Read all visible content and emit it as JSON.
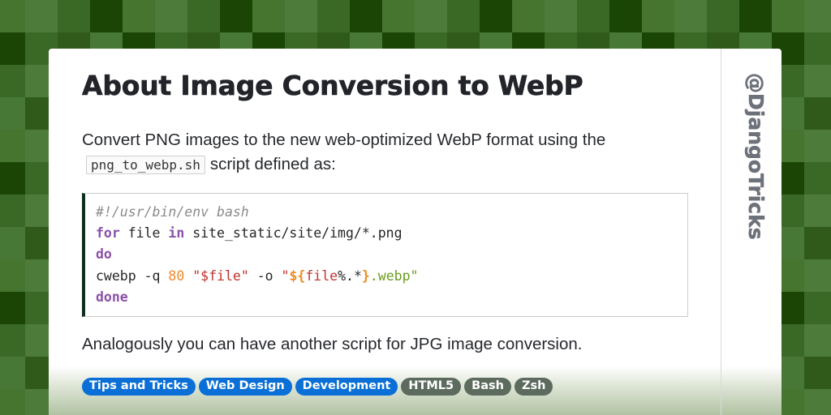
{
  "background": {
    "palette": [
      "#467530",
      "#4d7b3a",
      "#3a6925",
      "#1a4505",
      "#2f5a1a",
      "#487836",
      "#3d6c28"
    ]
  },
  "card": {
    "title": "About Image Conversion to WebP",
    "intro_before_code": "Convert PNG images to the new web-optimized WebP format using the",
    "inline_code": "png_to_webp.sh",
    "intro_after_code": "script defined as:",
    "code": {
      "language": "bash",
      "lines": [
        [
          {
            "t": "#!/usr/bin/env bash",
            "c": "comment"
          }
        ],
        [
          {
            "t": "for",
            "c": "kw"
          },
          {
            "t": " file ",
            "c": "plain"
          },
          {
            "t": "in",
            "c": "kw"
          },
          {
            "t": " site_static/site/img/*.png",
            "c": "plain"
          }
        ],
        [
          {
            "t": "do",
            "c": "kw"
          }
        ],
        [
          {
            "t": "cwebp -q ",
            "c": "plain"
          },
          {
            "t": "80",
            "c": "num"
          },
          {
            "t": " ",
            "c": "plain"
          },
          {
            "t": "\"$file\"",
            "c": "str"
          },
          {
            "t": " -o ",
            "c": "plain"
          },
          {
            "t": "\"",
            "c": "str"
          },
          {
            "t": "${",
            "c": "var"
          },
          {
            "t": "file",
            "c": "str"
          },
          {
            "t": "%.*",
            "c": "plain"
          },
          {
            "t": "}",
            "c": "var"
          },
          {
            "t": ".webp\"",
            "c": "str2"
          }
        ],
        [
          {
            "t": "done",
            "c": "kw"
          }
        ]
      ]
    },
    "outro": "Analogously you can have another script for JPG image conversion.",
    "tags": [
      {
        "label": "Tips and Tricks",
        "color": "#0a6fd6"
      },
      {
        "label": "Web Design",
        "color": "#0a6fd6"
      },
      {
        "label": "Development",
        "color": "#0a6fd6"
      },
      {
        "label": "HTML5",
        "color": "#5d6b5f"
      },
      {
        "label": "Bash",
        "color": "#5d6b5f"
      },
      {
        "label": "Zsh",
        "color": "#5d6b5f"
      }
    ],
    "handle": "@DjangoTricks"
  }
}
